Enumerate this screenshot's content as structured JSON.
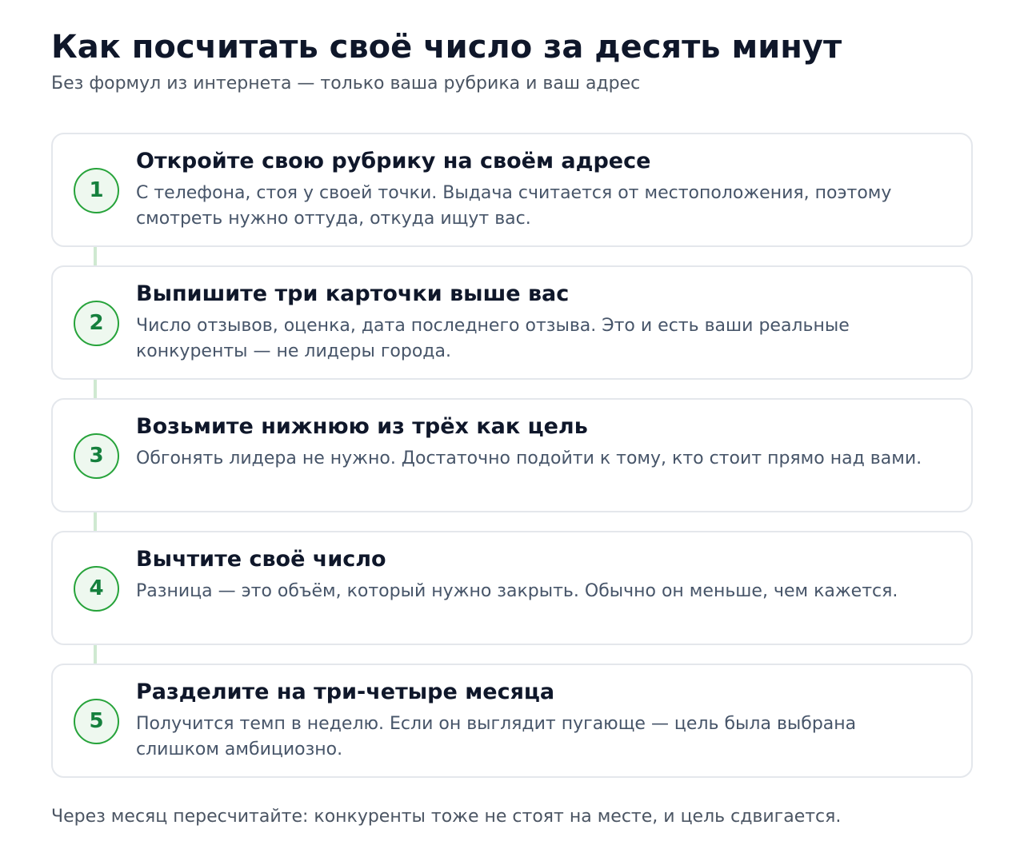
{
  "header": {
    "title": "Как посчитать своё число за десять минут",
    "subtitle": "Без формул из интернета — только ваша рубрика и ваш адрес"
  },
  "steps": [
    {
      "number": "1",
      "title": "Откройте свою рубрику на своём адресе",
      "text": "С телефона, стоя у своей точки. Выдача считается от местоположения, поэтому смотреть нужно оттуда, откуда ищут вас."
    },
    {
      "number": "2",
      "title": "Выпишите три карточки выше вас",
      "text": "Число отзывов, оценка, дата последнего отзыва. Это и есть ваши реальные конкуренты — не лидеры города."
    },
    {
      "number": "3",
      "title": "Возьмите нижнюю из трёх как цель",
      "text": "Обгонять лидера не нужно. Достаточно подойти к тому, кто стоит прямо над вами."
    },
    {
      "number": "4",
      "title": "Вычтите своё число",
      "text": "Разница — это объём, который нужно закрыть. Обычно он меньше, чем кажется."
    },
    {
      "number": "5",
      "title": "Разделите на три-четыре месяца",
      "text": "Получится темп в неделю. Если он выглядит пугающе — цель была выбрана слишком амбициозно."
    }
  ],
  "footer": {
    "note": "Через месяц пересчитайте: конкуренты тоже не стоят на месте, и цель сдвигается."
  },
  "colors": {
    "accent": "#26a33a",
    "accent_text": "#15803d",
    "accent_bg": "#eef8ef",
    "connector": "#cfe9d1",
    "card_border": "#e4e7ec"
  }
}
